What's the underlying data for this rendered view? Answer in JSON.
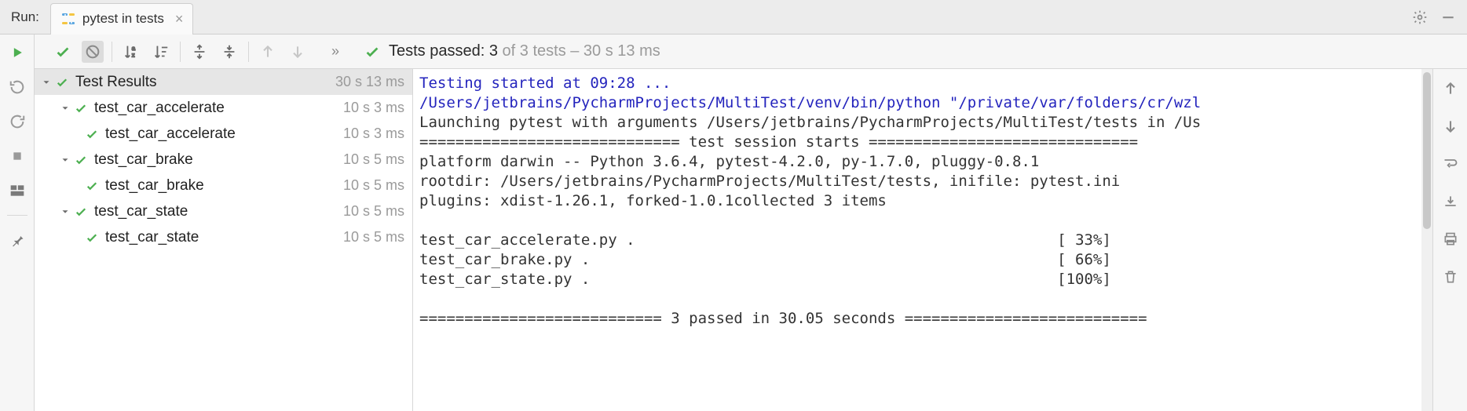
{
  "header": {
    "run_label": "Run:",
    "tab_label": "pytest in tests"
  },
  "status": {
    "prefix": "Tests passed:",
    "count": "3",
    "of": "of 3 tests – 30 s 13 ms"
  },
  "tree": {
    "root_label": "Test Results",
    "root_time": "30 s 13 ms",
    "nodes": [
      {
        "label": "test_car_accelerate",
        "time": "10 s 3 ms",
        "children": [
          {
            "label": "test_car_accelerate",
            "time": "10 s 3 ms"
          }
        ]
      },
      {
        "label": "test_car_brake",
        "time": "10 s 5 ms",
        "children": [
          {
            "label": "test_car_brake",
            "time": "10 s 5 ms"
          }
        ]
      },
      {
        "label": "test_car_state",
        "time": "10 s 5 ms",
        "children": [
          {
            "label": "test_car_state",
            "time": "10 s 5 ms"
          }
        ]
      }
    ]
  },
  "console": {
    "line1": "Testing started at 09:28 ...",
    "line2": "/Users/jetbrains/PycharmProjects/MultiTest/venv/bin/python \"/private/var/folders/cr/wzl",
    "line3": "Launching pytest with arguments /Users/jetbrains/PycharmProjects/MultiTest/tests in /Us",
    "line4": "============================= test session starts ==============================",
    "line5": "platform darwin -- Python 3.6.4, pytest-4.2.0, py-1.7.0, pluggy-0.8.1",
    "line6": "rootdir: /Users/jetbrains/PycharmProjects/MultiTest/tests, inifile: pytest.ini",
    "line7": "plugins: xdist-1.26.1, forked-1.0.1collected 3 items",
    "file1": "test_car_accelerate.py .",
    "pct1": "[ 33%]",
    "file2": "test_car_brake.py .",
    "pct2": "[ 66%]",
    "file3": "test_car_state.py .",
    "pct3": "[100%]",
    "summary": "=========================== 3 passed in 30.05 seconds ==========================="
  }
}
